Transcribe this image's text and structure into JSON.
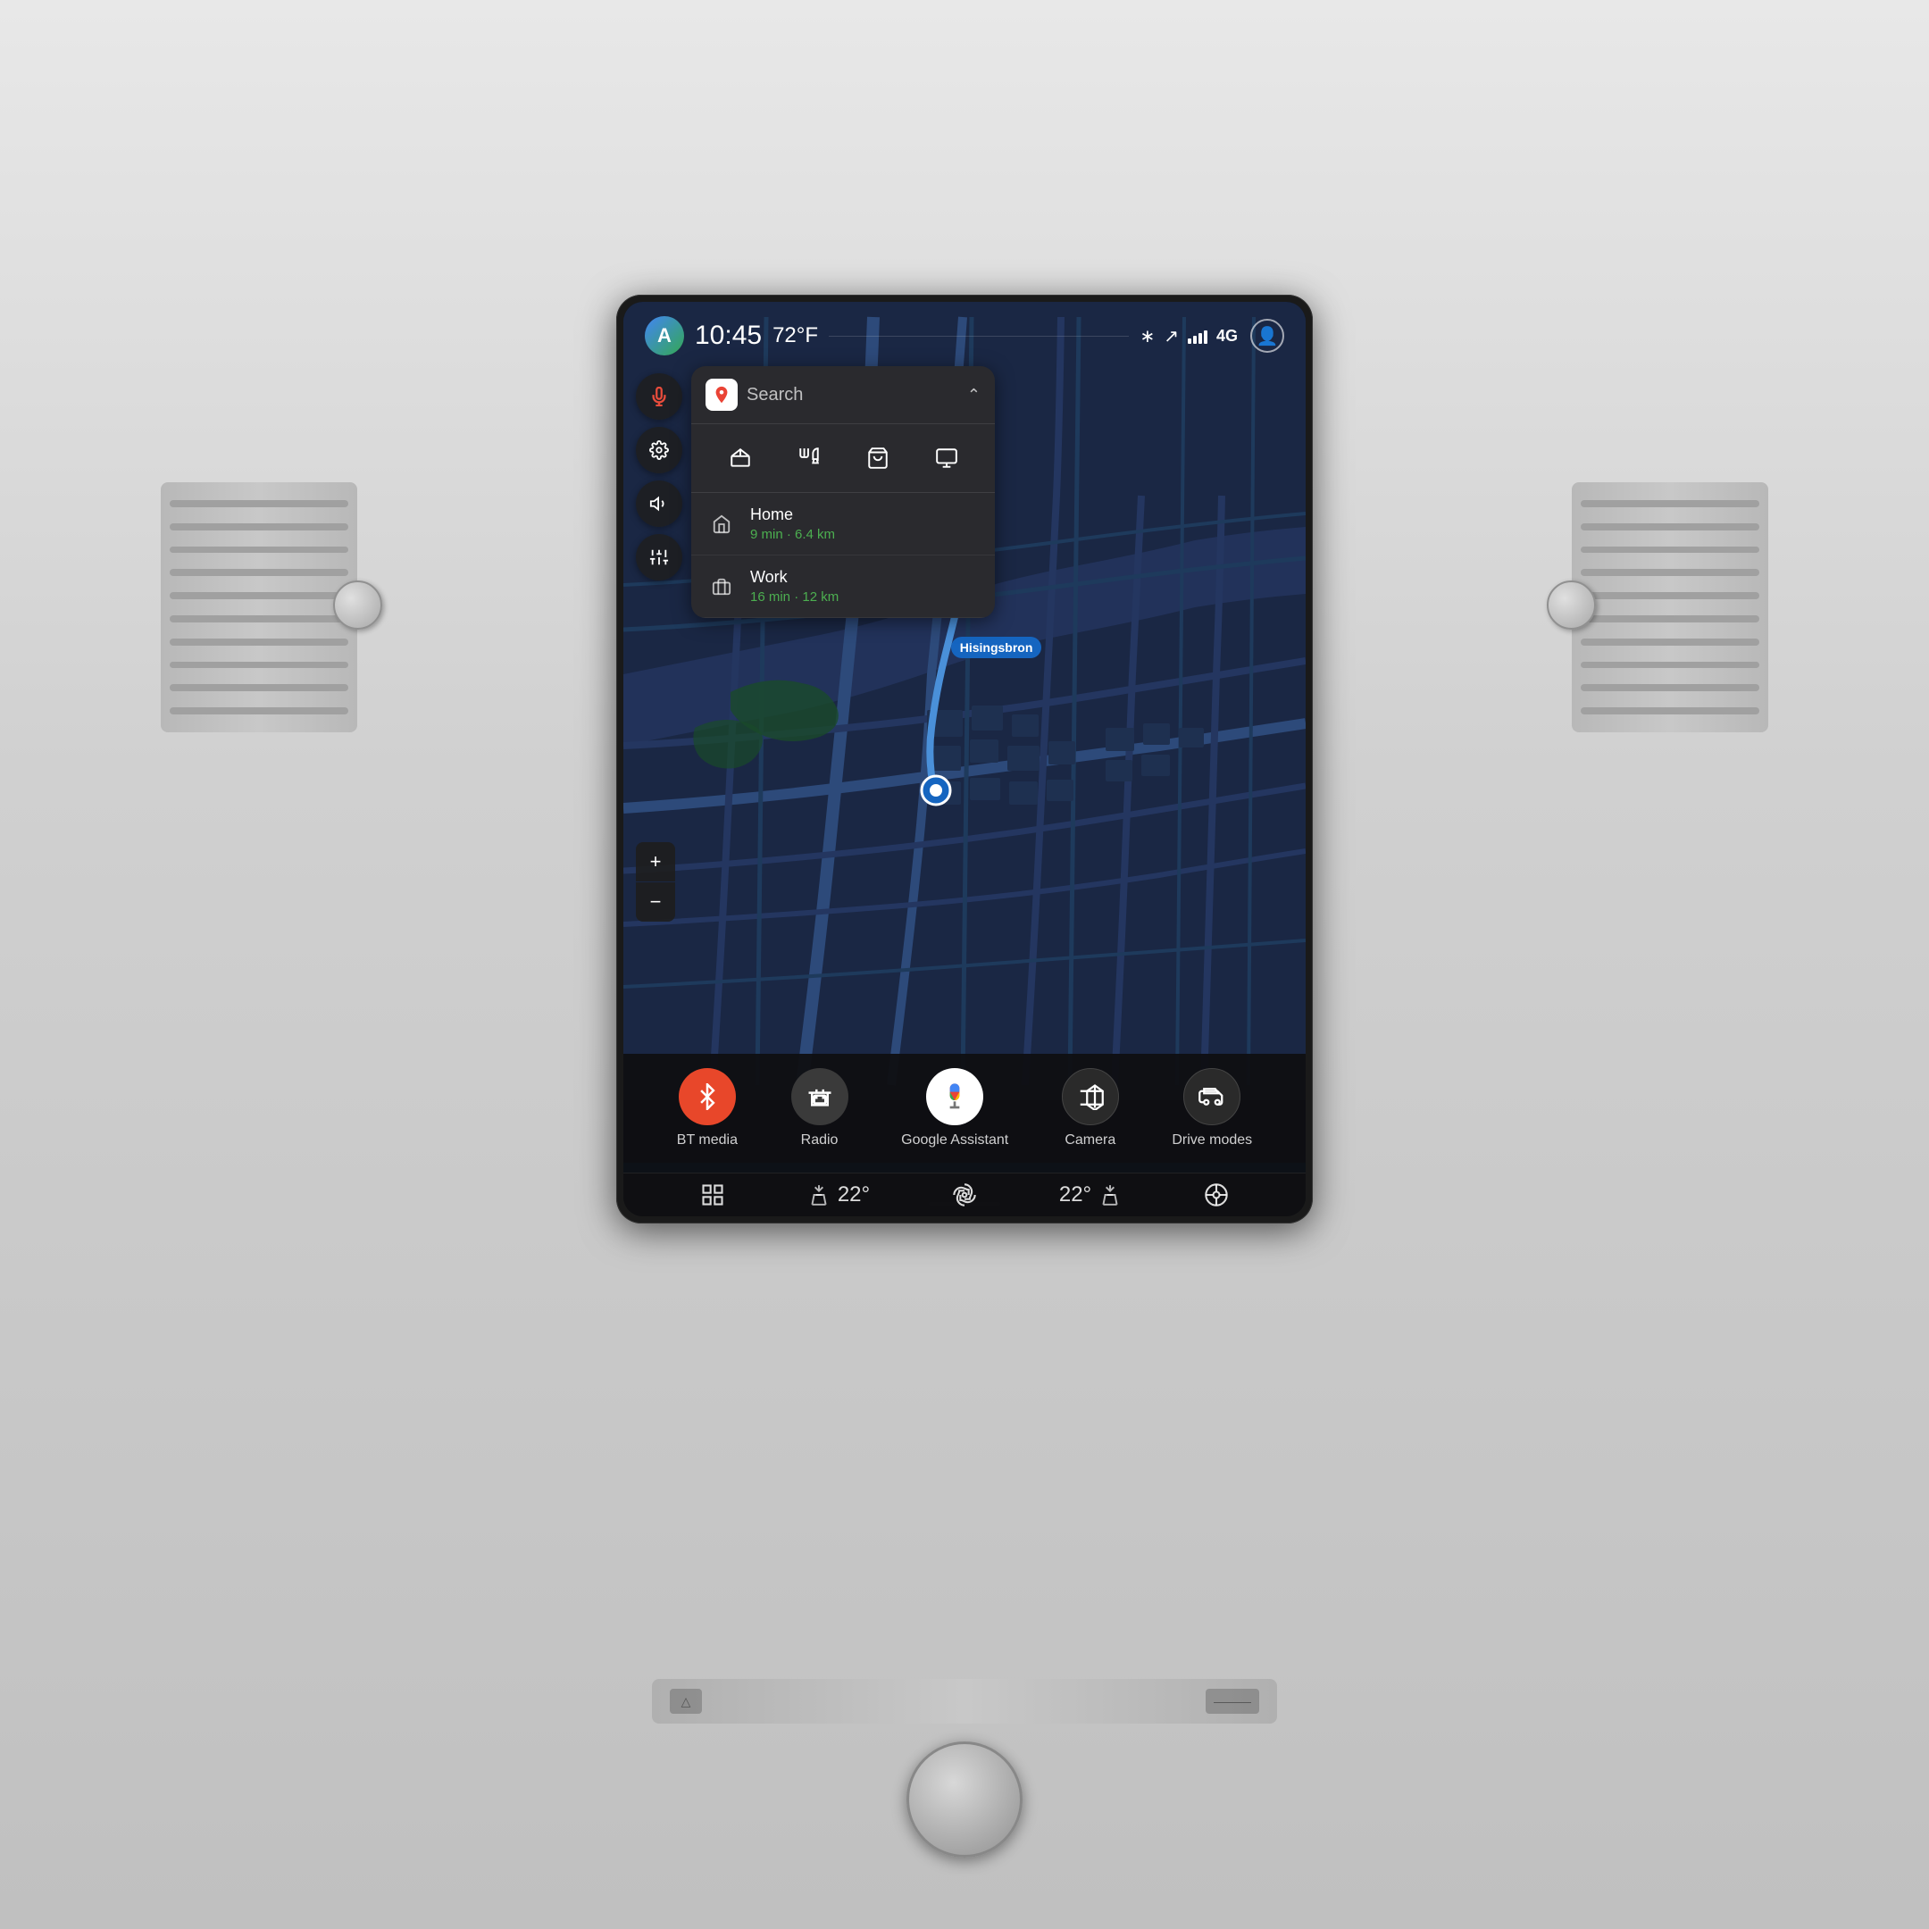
{
  "car": {
    "interior_bg": "#d8d8d8"
  },
  "status_bar": {
    "time": "10:45",
    "temperature": "72°F",
    "network": "4G",
    "android_auto_letter": "A"
  },
  "search_panel": {
    "search_placeholder": "Search",
    "categories": [
      "🏦",
      "🍴",
      "🛒",
      "🖥"
    ],
    "destinations": [
      {
        "name": "Home",
        "detail": "9 min · 6.4 km",
        "icon": "🏠"
      },
      {
        "name": "Work",
        "detail": "16 min · 12 km",
        "icon": "💼"
      }
    ]
  },
  "map": {
    "location_label": "Hisingsbron",
    "zoom_in": "+",
    "zoom_out": "−"
  },
  "dock": {
    "items": [
      {
        "label": "BT media",
        "type": "bt-media"
      },
      {
        "label": "Radio",
        "type": "radio"
      },
      {
        "label": "Google Assistant",
        "type": "google-assistant"
      },
      {
        "label": "Camera",
        "type": "camera"
      },
      {
        "label": "Drive modes",
        "type": "drive-modes"
      }
    ]
  },
  "climate": {
    "left_temp": "22°",
    "right_temp": "22°",
    "fan_icon": "fan",
    "seat_icon": "seat",
    "left_seat_icon": "seat-heat",
    "grid_icon": "grid"
  },
  "sidebar": {
    "buttons": [
      "mic",
      "settings",
      "volume",
      "equalizer"
    ]
  }
}
